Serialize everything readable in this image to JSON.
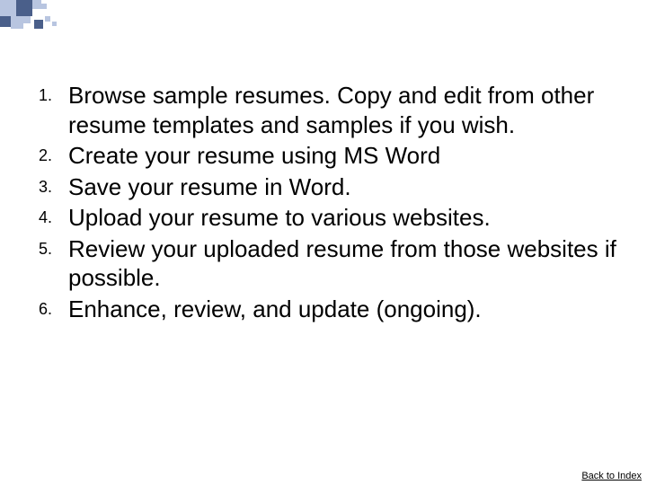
{
  "list": {
    "items": [
      {
        "num": "1.",
        "text": "Browse sample resumes. Copy and edit from other resume templates and samples if you wish."
      },
      {
        "num": "2.",
        "text": "Create your resume using MS Word"
      },
      {
        "num": "3.",
        "text": "Save your resume in Word."
      },
      {
        "num": "4.",
        "text": "Upload your resume to various websites."
      },
      {
        "num": "5.",
        "text": "Review your uploaded resume from those websites if possible."
      },
      {
        "num": "6.",
        "text": "Enhance, review, and update (ongoing)."
      }
    ]
  },
  "footer": {
    "back_link": "Back to Index"
  }
}
